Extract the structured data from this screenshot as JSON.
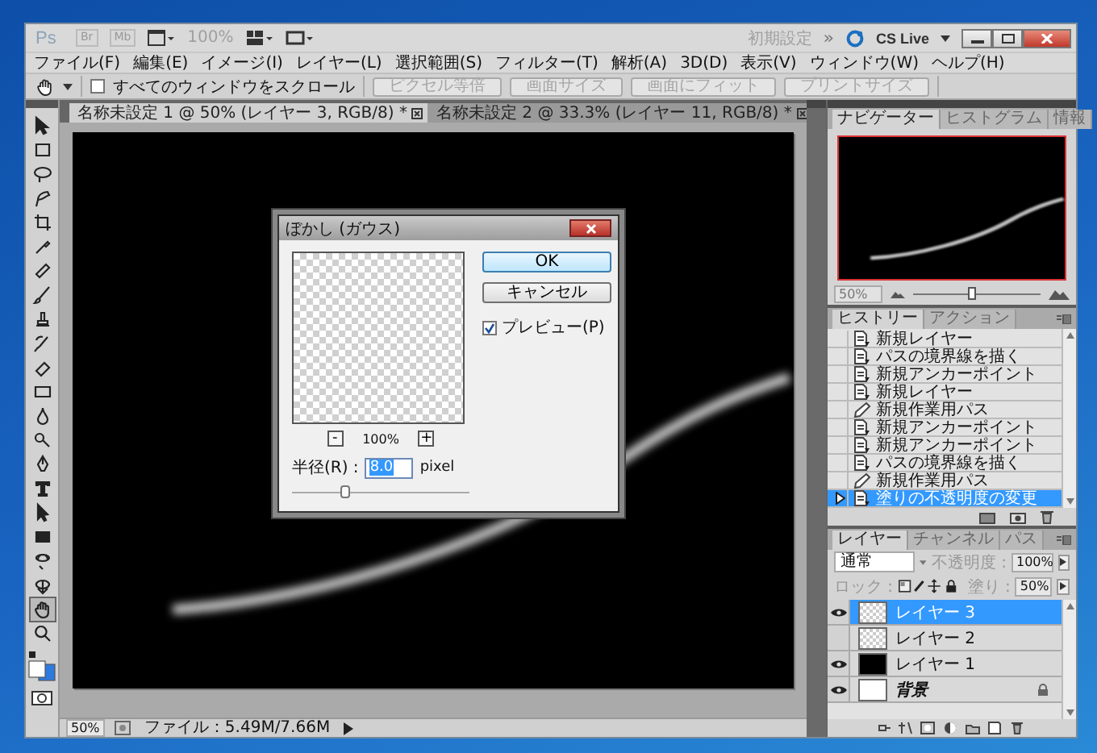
{
  "app": {
    "logo": "Ps",
    "launchers": [
      "Br",
      "Mb"
    ],
    "zoom": "100%",
    "workspace": "初期設定",
    "more": "»",
    "cs_live": "CS Live"
  },
  "menu": [
    "ファイル(F)",
    "編集(E)",
    "イメージ(I)",
    "レイヤー(L)",
    "選択範囲(S)",
    "フィルター(T)",
    "解析(A)",
    "3D(D)",
    "表示(V)",
    "ウィンドウ(W)",
    "ヘルプ(H)"
  ],
  "options_bar": {
    "scroll_all": {
      "label": "すべてのウィンドウをスクロール",
      "checked": false
    },
    "buttons": [
      {
        "label": "ピクセル等倍",
        "disabled": true
      },
      {
        "label": "画面サイズ",
        "disabled": true
      },
      {
        "label": "画面にフィット",
        "disabled": true
      },
      {
        "label": "プリントサイズ",
        "disabled": true
      }
    ]
  },
  "tools": [
    {
      "kind": "move",
      "selected": false
    },
    {
      "kind": "marquee",
      "selected": false
    },
    {
      "kind": "lasso",
      "selected": false
    },
    {
      "kind": "quick-select",
      "selected": false
    },
    {
      "kind": "crop",
      "selected": false
    },
    {
      "kind": "eyedropper",
      "selected": false
    },
    {
      "kind": "healing",
      "selected": false
    },
    {
      "kind": "brush",
      "selected": false
    },
    {
      "kind": "stamp",
      "selected": false
    },
    {
      "kind": "history-brush",
      "selected": false
    },
    {
      "kind": "eraser",
      "selected": false
    },
    {
      "kind": "gradient",
      "selected": false
    },
    {
      "kind": "blur",
      "selected": false
    },
    {
      "kind": "dodge",
      "selected": false
    },
    {
      "kind": "pen",
      "selected": false
    },
    {
      "kind": "type",
      "selected": false
    },
    {
      "kind": "path-select",
      "selected": false
    },
    {
      "kind": "shape",
      "selected": false
    },
    {
      "kind": "rotate-3d",
      "selected": false
    },
    {
      "kind": "orbit-3d",
      "selected": false
    },
    {
      "kind": "hand",
      "selected": true
    },
    {
      "kind": "zoom",
      "selected": false
    }
  ],
  "documents": [
    {
      "title": "名称未設定 1 @ 50% (レイヤー 3, RGB/8) *",
      "selected": true
    },
    {
      "title": "名称未設定 2 @ 33.3% (レイヤー 11, RGB/8) *",
      "selected": false
    }
  ],
  "status_bar": {
    "zoom": "50%",
    "file": "ファイル：5.49M/7.66M"
  },
  "dialog": {
    "title": "ぼかし (ガウス)",
    "ok": "OK",
    "cancel": "キャンセル",
    "preview": {
      "label": "プレビュー(P)",
      "checked": true
    },
    "zoom_out": "-",
    "zoom": "100%",
    "zoom_in": "+",
    "radius_label": "半径(R) :",
    "radius": "8.0",
    "unit": "pixel",
    "level": 0.3
  },
  "navigator": {
    "tabs": [
      {
        "label": "ナビゲーター",
        "selected": true
      },
      {
        "label": "ヒストグラム",
        "selected": false
      },
      {
        "label": "情報",
        "selected": false
      }
    ],
    "zoom": "50%",
    "level": 0.45
  },
  "history": {
    "tabs": [
      {
        "label": "ヒストリー",
        "selected": true
      },
      {
        "label": "アクション",
        "selected": false
      }
    ],
    "items": [
      {
        "label": "新規レイヤー",
        "kind": "document",
        "selected": false
      },
      {
        "label": "パスの境界線を描く",
        "kind": "document",
        "selected": false
      },
      {
        "label": "新規アンカーポイント",
        "kind": "document",
        "selected": false
      },
      {
        "label": "新規レイヤー",
        "kind": "document",
        "selected": false
      },
      {
        "label": "新規作業用パス",
        "kind": "pen",
        "selected": false
      },
      {
        "label": "新規アンカーポイント",
        "kind": "document",
        "selected": false
      },
      {
        "label": "新規アンカーポイント",
        "kind": "document",
        "selected": false
      },
      {
        "label": "パスの境界線を描く",
        "kind": "document",
        "selected": false
      },
      {
        "label": "新規作業用パス",
        "kind": "pen",
        "selected": false
      },
      {
        "label": "塗りの不透明度の変更",
        "kind": "document",
        "selected": true
      }
    ]
  },
  "layers": {
    "tabs": [
      {
        "label": "レイヤー",
        "selected": true
      },
      {
        "label": "チャンネル",
        "selected": false
      },
      {
        "label": "パス",
        "selected": false
      }
    ],
    "blend_mode": "通常",
    "opacity_label": "不透明度 :",
    "opacity": "100%",
    "lock_label": "ロック :",
    "fill_label": "塗り :",
    "fill": "50%",
    "items": [
      {
        "name": "レイヤー 3",
        "kind": "transparent",
        "visible": true,
        "selected": true
      },
      {
        "name": "レイヤー 2",
        "kind": "transparent",
        "visible": false,
        "selected": false
      },
      {
        "name": "レイヤー 1",
        "kind": "black",
        "visible": true,
        "selected": false
      },
      {
        "name": "背景",
        "kind": "background",
        "visible": true,
        "selected": false
      }
    ]
  }
}
